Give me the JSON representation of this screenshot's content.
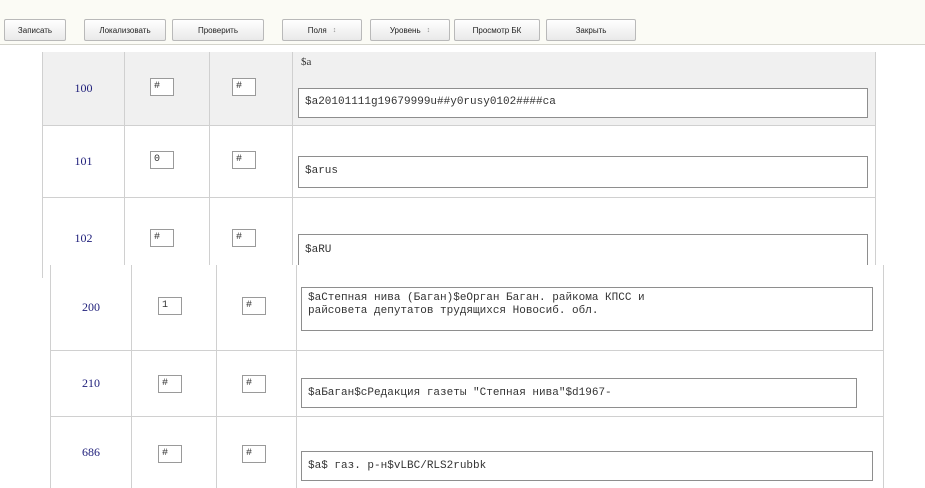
{
  "toolbar": {
    "buttons": [
      {
        "label": "Записать"
      },
      {
        "label": "Локализовать"
      },
      {
        "label": "Проверить"
      },
      {
        "label": "Поля",
        "dropdown": true
      },
      {
        "label": "Уровень",
        "dropdown": true
      },
      {
        "label": "Просмотр БК"
      },
      {
        "label": "Закрыть"
      }
    ]
  },
  "rows": [
    {
      "tag": "100",
      "ind1": "#",
      "ind2": "#",
      "subfield_label": "$a",
      "value": "$a20101111g19679999u##y0rusy0102####ca"
    },
    {
      "tag": "101",
      "ind1": "0",
      "ind2": "#",
      "value": "$arus"
    },
    {
      "tag": "102",
      "ind1": "#",
      "ind2": "#",
      "value": "$aRU"
    },
    {
      "tag": "200",
      "ind1": "1",
      "ind2": "#",
      "value": "$aСтепная нива (Баган)$eОрган Баган. райкома КПСС и\nрайсовета депутатов трудящихся Новосиб. обл."
    },
    {
      "tag": "210",
      "ind1": "#",
      "ind2": "#",
      "value": "$aБаган$cРедакция газеты \"Степная нива\"$d1967-"
    },
    {
      "tag": "686",
      "ind1": "#",
      "ind2": "#",
      "value": "$a$ газ. р-н$vLBC/RLS2rubbk"
    }
  ]
}
